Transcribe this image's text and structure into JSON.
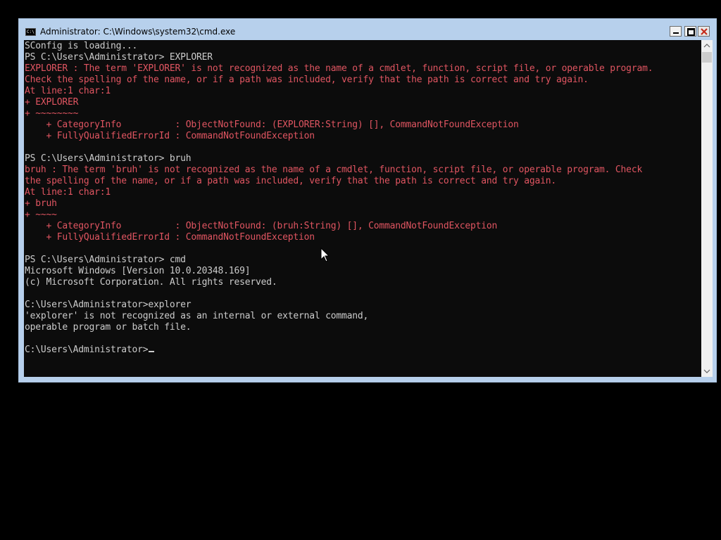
{
  "window": {
    "title": "Administrator: C:\\Windows\\system32\\cmd.exe",
    "icon_label": "C:\\"
  },
  "console": {
    "lines": [
      {
        "text": "SConfig is loading...",
        "kind": "normal"
      },
      {
        "text": "PS C:\\Users\\Administrator> EXPLORER",
        "kind": "normal"
      },
      {
        "text": "EXPLORER : The term 'EXPLORER' is not recognized as the name of a cmdlet, function, script file, or operable program.",
        "kind": "error"
      },
      {
        "text": "Check the spelling of the name, or if a path was included, verify that the path is correct and try again.",
        "kind": "error"
      },
      {
        "text": "At line:1 char:1",
        "kind": "error"
      },
      {
        "text": "+ EXPLORER",
        "kind": "error"
      },
      {
        "text": "+ ~~~~~~~~",
        "kind": "error"
      },
      {
        "text": "    + CategoryInfo          : ObjectNotFound: (EXPLORER:String) [], CommandNotFoundException",
        "kind": "error"
      },
      {
        "text": "    + FullyQualifiedErrorId : CommandNotFoundException",
        "kind": "error"
      },
      {
        "text": "",
        "kind": "normal"
      },
      {
        "text": "PS C:\\Users\\Administrator> bruh",
        "kind": "normal"
      },
      {
        "text": "bruh : The term 'bruh' is not recognized as the name of a cmdlet, function, script file, or operable program. Check",
        "kind": "error"
      },
      {
        "text": "the spelling of the name, or if a path was included, verify that the path is correct and try again.",
        "kind": "error"
      },
      {
        "text": "At line:1 char:1",
        "kind": "error"
      },
      {
        "text": "+ bruh",
        "kind": "error"
      },
      {
        "text": "+ ~~~~",
        "kind": "error"
      },
      {
        "text": "    + CategoryInfo          : ObjectNotFound: (bruh:String) [], CommandNotFoundException",
        "kind": "error"
      },
      {
        "text": "    + FullyQualifiedErrorId : CommandNotFoundException",
        "kind": "error"
      },
      {
        "text": "",
        "kind": "normal"
      },
      {
        "text": "PS C:\\Users\\Administrator> cmd",
        "kind": "normal"
      },
      {
        "text": "Microsoft Windows [Version 10.0.20348.169]",
        "kind": "normal"
      },
      {
        "text": "(c) Microsoft Corporation. All rights reserved.",
        "kind": "normal"
      },
      {
        "text": "",
        "kind": "normal"
      },
      {
        "text": "C:\\Users\\Administrator>explorer",
        "kind": "normal"
      },
      {
        "text": "'explorer' is not recognized as an internal or external command,",
        "kind": "normal"
      },
      {
        "text": "operable program or batch file.",
        "kind": "normal"
      },
      {
        "text": "",
        "kind": "normal"
      },
      {
        "text": "C:\\Users\\Administrator>",
        "kind": "prompt"
      }
    ]
  },
  "colors": {
    "console_bg": "#0c0c0c",
    "text": "#cccccc",
    "error": "#e05561",
    "titlebar": "#b7d0ec"
  },
  "icons": {
    "window": "cmd-icon",
    "minimize": "minimize-icon",
    "maximize": "maximize-icon",
    "close": "close-icon",
    "scroll_up": "chevron-up-icon",
    "scroll_down": "chevron-down-icon",
    "pointer": "mouse-pointer-icon"
  }
}
